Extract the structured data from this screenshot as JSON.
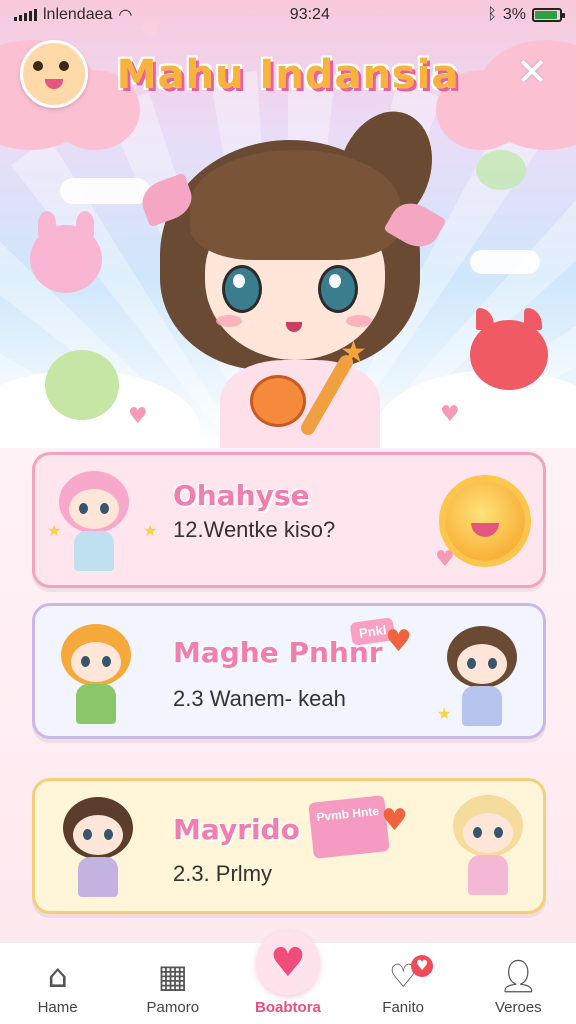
{
  "status_bar": {
    "carrier": "lnlendaea",
    "time": "93:24",
    "battery_text": "3%",
    "bluetooth_icon": "bluetooth-icon",
    "wifi_icon": "wifi-icon"
  },
  "header": {
    "title": "Mahu Indansia",
    "avatar_icon": "hamster-avatar-icon",
    "close_icon": "close-icon"
  },
  "cards": [
    {
      "title": "Ohahyse",
      "subtitle": "12.Wentke kiso?",
      "left_icon": "pink-hair-chibi-icon",
      "right_icon": "sun-icon"
    },
    {
      "title": "Maghe Pnhnr",
      "subtitle": "2.3 Wanem- keah",
      "tag_text": "Pnkl",
      "left_icon": "green-dress-chibi-icon",
      "right_icon": "brown-hair-chibi-icon"
    },
    {
      "title": "Mayrido",
      "subtitle": "2.3. Prlmy",
      "box_text": "Pvmb Hnte",
      "left_icon": "bun-hair-chibi-icon",
      "right_icon": "blonde-chibi-icon"
    }
  ],
  "bottom_nav": [
    {
      "label": "Hame",
      "icon": "home-icon"
    },
    {
      "label": "Pamoro",
      "icon": "grid-icon"
    },
    {
      "label": "Boabtora",
      "icon": "heart-icon",
      "active": true
    },
    {
      "label": "Fanito",
      "icon": "check-heart-icon"
    },
    {
      "label": "Veroes",
      "icon": "user-icon"
    }
  ],
  "colors": {
    "accent_pink": "#ee4d7e",
    "title_gold": "#f7b33c",
    "card1_border": "#f2a3c0",
    "card2_border": "#c8b7ea",
    "card3_border": "#f4cf7a"
  }
}
